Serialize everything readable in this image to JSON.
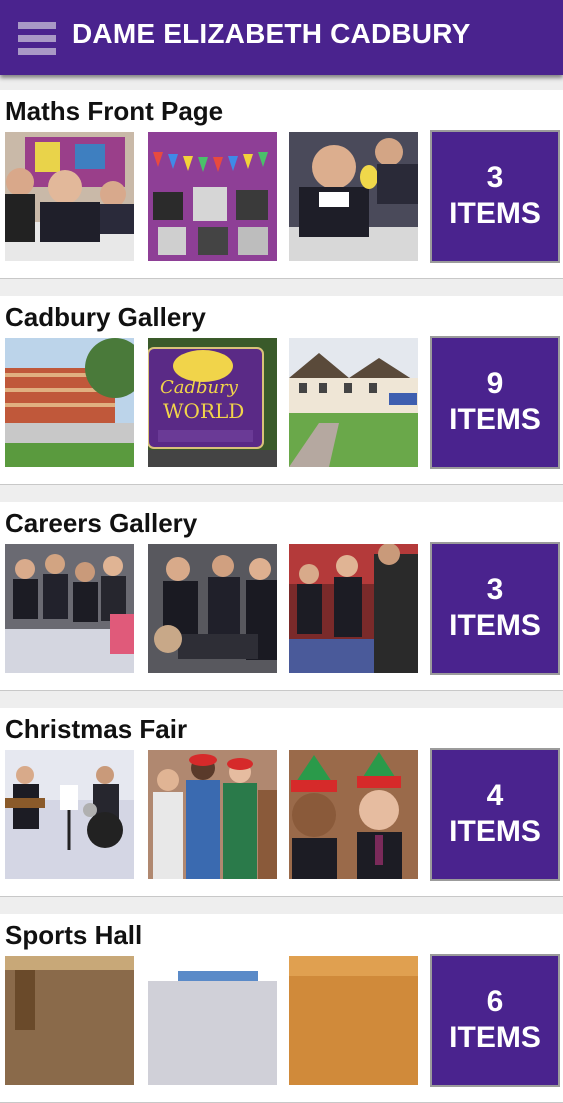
{
  "header": {
    "title": "DAME ELIZABETH CADBURY",
    "menu_icon": "hamburger-menu-icon",
    "background": "#4a238e"
  },
  "galleries": [
    {
      "title": "Maths Front Page",
      "count": "3",
      "count_label": "ITEMS"
    },
    {
      "title": "Cadbury Gallery",
      "count": "9",
      "count_label": "ITEMS"
    },
    {
      "title": "Careers Gallery",
      "count": "3",
      "count_label": "ITEMS"
    },
    {
      "title": "Christmas Fair",
      "count": "4",
      "count_label": "ITEMS"
    },
    {
      "title": "Sports Hall",
      "count": "6",
      "count_label": "ITEMS"
    }
  ]
}
